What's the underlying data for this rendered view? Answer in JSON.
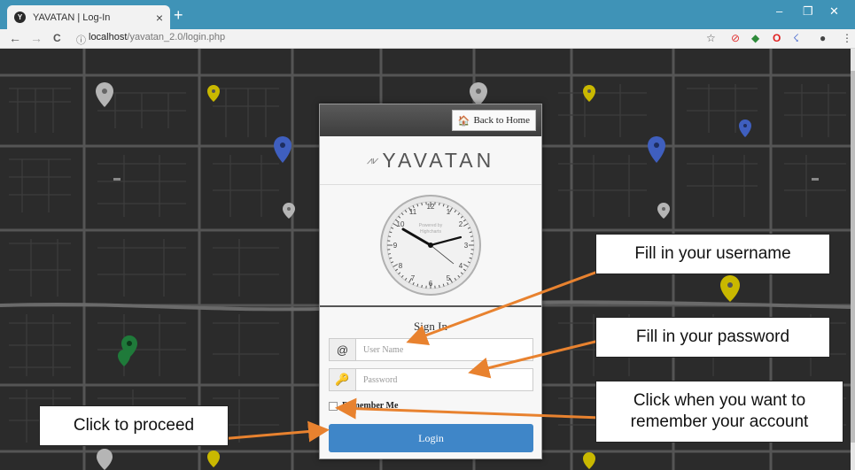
{
  "browser": {
    "tab_title": "YAVATAN | Log-In",
    "tab_close": "×",
    "new_tab": "+",
    "url_host": "localhost",
    "url_path": "/yavatan_2.0/login.php",
    "controls": {
      "minimize": "–",
      "maximize": "❐",
      "close": "✕"
    },
    "nav": {
      "back": "←",
      "forward": "→",
      "reload": "C"
    }
  },
  "card": {
    "back_home_label": "Back to Home",
    "brand": "YAVATAN",
    "clock": {
      "powered_by": "Powered by",
      "vendor": "Highcharts"
    },
    "sign_in_title": "Sign In",
    "username": {
      "icon": "@",
      "placeholder": "User Name",
      "value": ""
    },
    "password": {
      "icon": "🔑",
      "placeholder": "Password",
      "value": ""
    },
    "remember_label": "Remember Me",
    "login_label": "Login"
  },
  "callouts": {
    "username": "Fill in your username",
    "password": "Fill in your password",
    "remember": "Click when you want to remember your account",
    "proceed": "Click to proceed"
  },
  "colors": {
    "tabbar": "#3f93b7",
    "map_bg": "#2b2b2b",
    "login_button": "#3f86c8",
    "arrow": "#e8822f",
    "marker_gray": "#b5b5b5",
    "marker_yellow": "#c9b800",
    "marker_blue": "#3f5fbf",
    "marker_green": "#1f7a3a"
  }
}
